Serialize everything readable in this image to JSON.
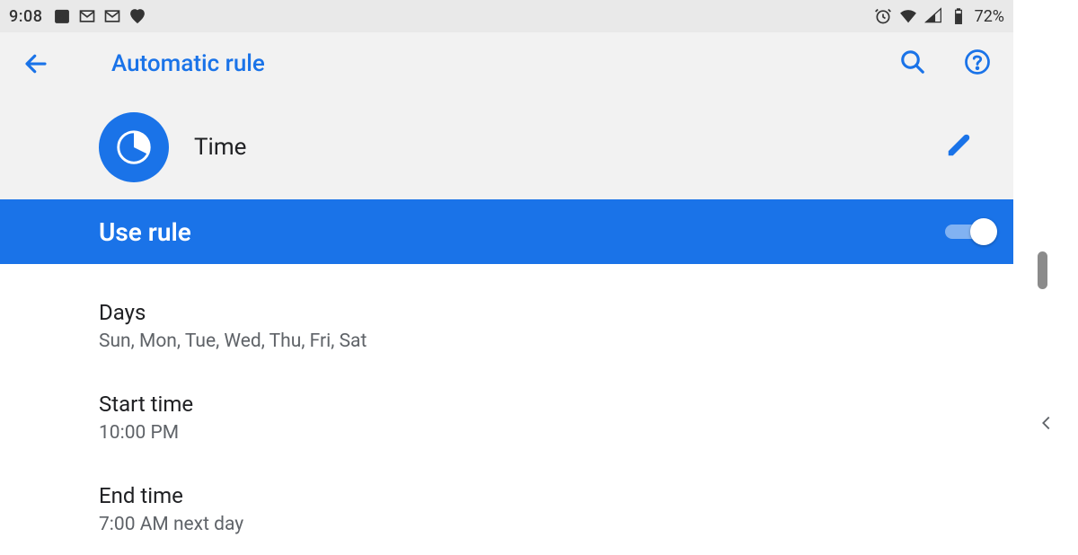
{
  "status": {
    "time": "9:08",
    "battery_percent": "72%"
  },
  "appbar": {
    "title": "Automatic rule"
  },
  "rule": {
    "name": "Time"
  },
  "use_rule": {
    "label": "Use rule",
    "enabled": true
  },
  "settings": {
    "days": {
      "title": "Days",
      "value": "Sun, Mon, Tue, Wed, Thu, Fri, Sat"
    },
    "start_time": {
      "title": "Start time",
      "value": "10:00 PM"
    },
    "end_time": {
      "title": "End time",
      "value": "7:00 AM next day"
    }
  },
  "colors": {
    "accent": "#1a73e8"
  }
}
